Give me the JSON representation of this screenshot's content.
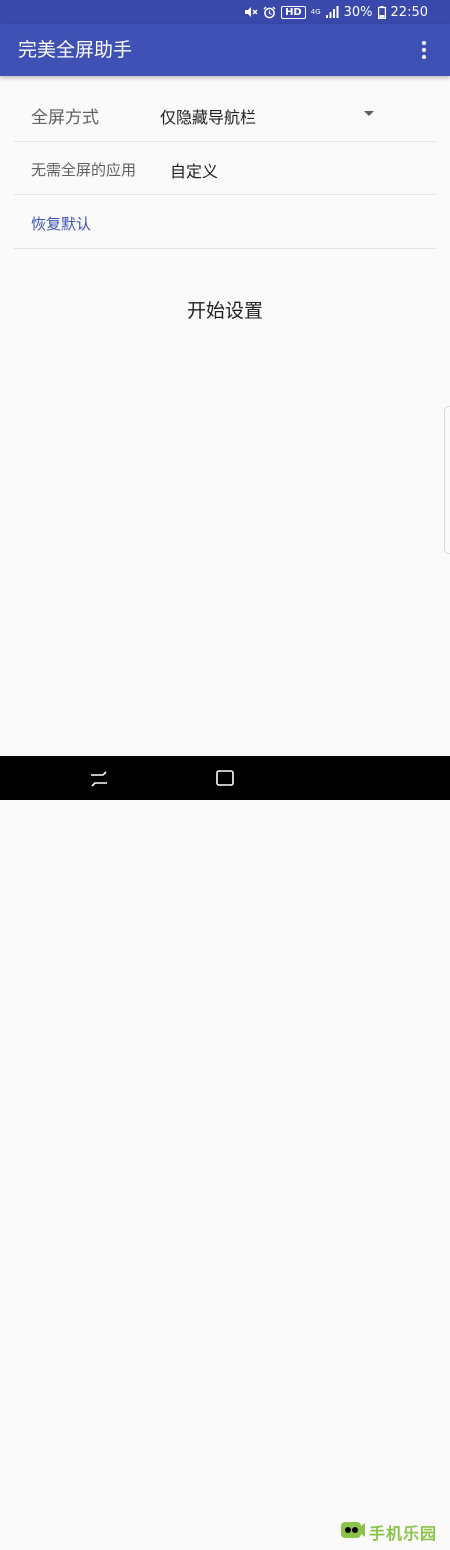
{
  "status_bar": {
    "hd_badge": "HD",
    "network_label": "4G",
    "battery_percent": "30%",
    "time": "22:50",
    "icons": [
      "mute-icon",
      "alarm-icon",
      "signal-icon",
      "battery-icon"
    ]
  },
  "app_bar": {
    "title": "完美全屏助手",
    "menu_icon": "more-vert-icon",
    "background_color": "#3f51b5"
  },
  "settings": {
    "mode_label": "全屏方式",
    "mode_value": "仅隐藏导航栏",
    "apps_label": "无需全屏的应用",
    "apps_value": "自定义",
    "reset_label": "恢复默认"
  },
  "start_button_label": "开始设置",
  "nav_bar": {
    "icons": [
      "recent-apps-icon",
      "home-icon"
    ]
  },
  "watermark": {
    "text": "手机乐园",
    "icon": "logo-icon"
  }
}
